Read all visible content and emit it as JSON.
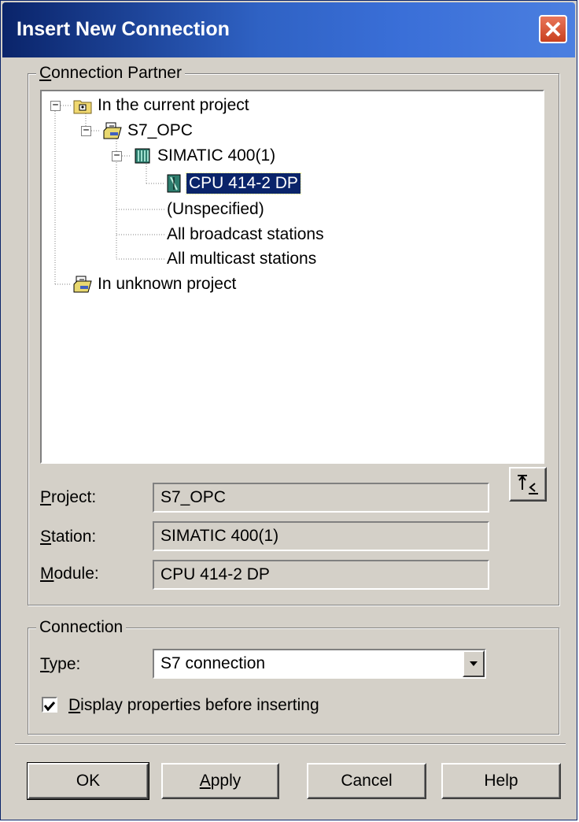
{
  "window": {
    "title": "Insert New Connection"
  },
  "partner": {
    "legend_first": "C",
    "legend_rest": "onnection Partner",
    "tree": [
      {
        "label": "In the current project",
        "icon": "folder-icon"
      },
      {
        "label": "S7_OPC",
        "icon": "project-icon"
      },
      {
        "label": "SIMATIC 400(1)",
        "icon": "station-icon"
      },
      {
        "label": "CPU 414-2 DP",
        "icon": "cpu-icon",
        "selected": true
      },
      {
        "label": "(Unspecified)"
      },
      {
        "label": "All broadcast stations"
      },
      {
        "label": "All multicast stations"
      },
      {
        "label": "In unknown project",
        "icon": "project-icon"
      }
    ],
    "project_label_first": "P",
    "project_label_rest": "roject:",
    "project_value": "S7_OPC",
    "station_label_first": "S",
    "station_label_rest": "tation:",
    "station_value": "SIMATIC 400(1)",
    "module_label_first": "M",
    "module_label_rest": "odule:",
    "module_value": "CPU 414-2 DP"
  },
  "connection": {
    "legend": "Connection",
    "type_label_first": "T",
    "type_label_rest": "ype:",
    "type_value": "S7 connection",
    "display_props_first": "D",
    "display_props_rest": "isplay properties before inserting",
    "display_props_checked": true
  },
  "buttons": {
    "ok": "OK",
    "apply_first": "A",
    "apply_rest": "pply",
    "cancel": "Cancel",
    "help": "Help"
  }
}
